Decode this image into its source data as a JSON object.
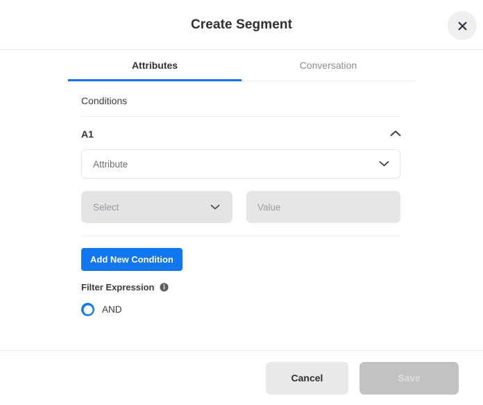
{
  "header": {
    "title": "Create Segment",
    "close_icon": "close-icon"
  },
  "tabs": [
    {
      "label": "Attributes",
      "active": true
    },
    {
      "label": "Conversation",
      "active": false
    }
  ],
  "body": {
    "conditions_label": "Conditions",
    "group": {
      "name": "A1",
      "collapse_icon": "chevron-up-icon"
    },
    "fields": {
      "attribute_select": {
        "placeholder": "Attribute",
        "value": "",
        "icon": "chevron-down-icon",
        "disabled": false
      },
      "operator_select": {
        "placeholder": "Select",
        "value": "",
        "icon": "chevron-down-icon",
        "disabled": true
      },
      "value_input": {
        "placeholder": "Value",
        "value": "",
        "disabled": true
      }
    },
    "add_condition_label": "Add New Condition",
    "filter_expression": {
      "label": "Filter Expression",
      "info_icon": "info-icon",
      "options": [
        {
          "label": "AND",
          "selected": true
        }
      ]
    }
  },
  "footer": {
    "cancel_label": "Cancel",
    "save_label": "Save",
    "save_disabled": true
  },
  "colors": {
    "accent_blue": "#1077f0",
    "tab_underline": "#1370ef",
    "title_text": "#2f2f33",
    "muted_text": "#9a9aa0",
    "disabled_field_bg": "#e4e4e5",
    "cancel_bg": "#e9e9ea",
    "save_disabled_bg": "#c2c2c3"
  }
}
